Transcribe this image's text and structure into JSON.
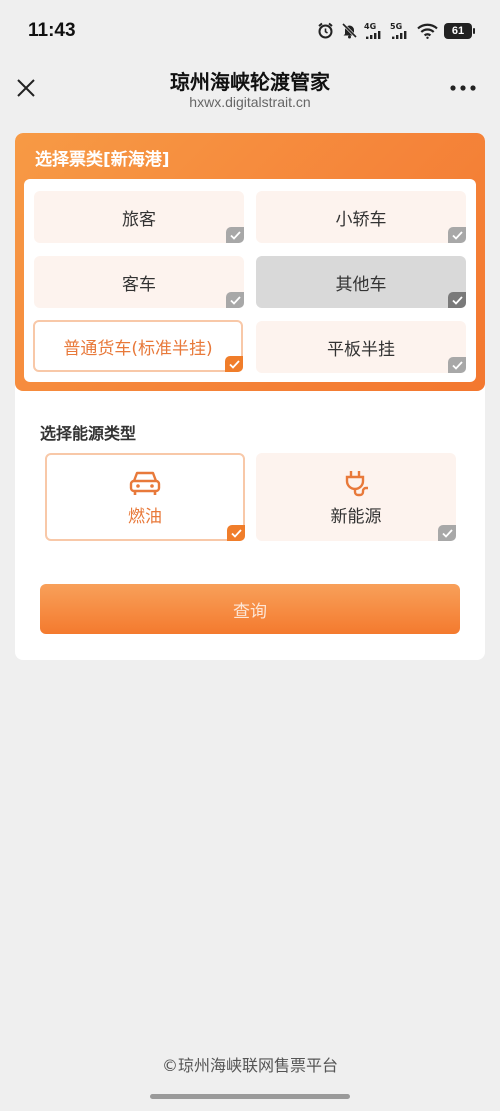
{
  "status_bar": {
    "time": "11:43",
    "network1": "4G",
    "network2": "5G",
    "battery": "61",
    "icons": [
      "alarm-icon",
      "mute-icon",
      "signal-4g-icon",
      "signal-5g-icon",
      "wifi-icon",
      "battery-icon"
    ]
  },
  "header": {
    "title": "琼州海峡轮渡管家",
    "subtitle": "hxwx.digitalstrait.cn"
  },
  "ticket": {
    "title": "选择票类[新海港]",
    "options": [
      {
        "label": "旅客",
        "state": "normal"
      },
      {
        "label": "小轿车",
        "state": "normal"
      },
      {
        "label": "客车",
        "state": "normal"
      },
      {
        "label": "其他车",
        "state": "disabled"
      },
      {
        "label": "普通货车(标准半挂)",
        "state": "selected"
      },
      {
        "label": "平板半挂",
        "state": "normal"
      }
    ]
  },
  "energy": {
    "title": "选择能源类型",
    "options": [
      {
        "label": "燃油",
        "icon": "car-icon",
        "state": "selected"
      },
      {
        "label": "新能源",
        "icon": "plug-icon",
        "state": "normal"
      }
    ]
  },
  "query_label": "查询",
  "footer": "©琼州海峡联网售票平台",
  "colors": {
    "accent": "#f5853a",
    "selected_text": "#e8793a",
    "option_bg": "#fdf3ee"
  }
}
